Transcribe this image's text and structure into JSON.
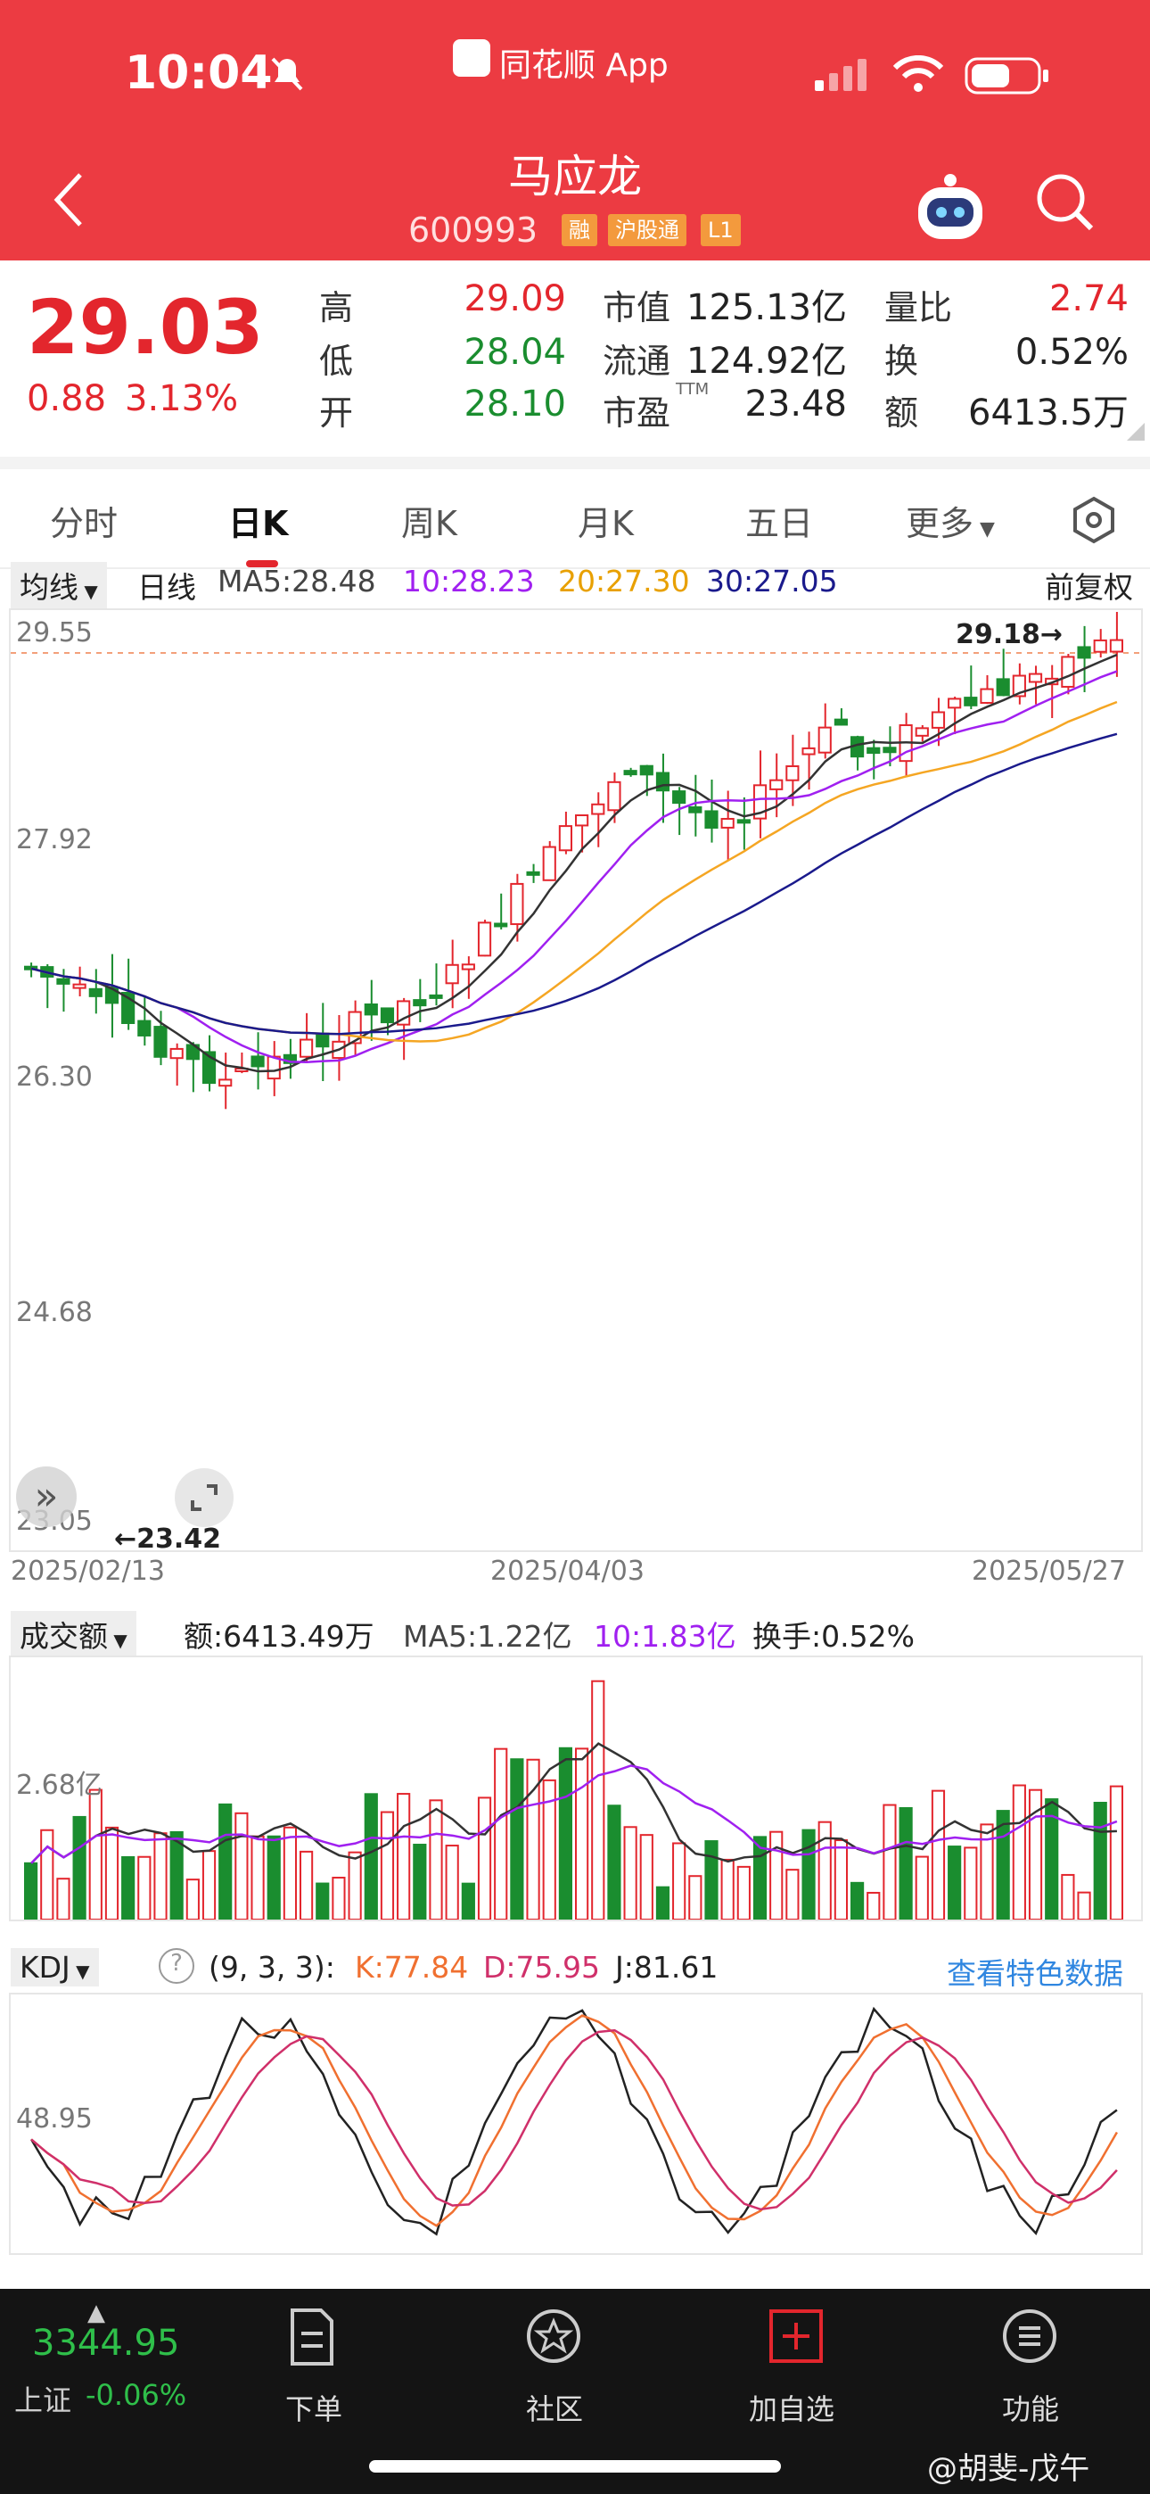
{
  "status": {
    "time": "10:04",
    "app_name": "同花顺 App"
  },
  "header": {
    "title": "马应龙",
    "code": "600993",
    "badges": [
      "融",
      "沪股通",
      "L1"
    ]
  },
  "quote": {
    "price": "29.03",
    "change": "0.88",
    "change_pct": "3.13%",
    "high_label": "高",
    "high": "29.09",
    "low_label": "低",
    "low": "28.04",
    "open_label": "开",
    "open": "28.10",
    "mcap_label": "市值",
    "mcap": "125.13亿",
    "float_label": "流通",
    "float": "124.92亿",
    "pe_label": "市盈",
    "pe_sup": "TTM",
    "pe": "23.48",
    "vr_label": "量比",
    "vr": "2.74",
    "turn_label": "换",
    "turn": "0.52%",
    "amt_label": "额",
    "amt": "6413.5万"
  },
  "tabs": [
    "分时",
    "日K",
    "周K",
    "月K",
    "五日",
    "更多"
  ],
  "kline": {
    "ma_selector": "均线",
    "period": "日线",
    "ma5": "MA5:28.48",
    "ma10": "10:28.23",
    "ma20": "20:27.30",
    "ma30": "30:27.05",
    "adjust": "前复权",
    "y_labels": [
      "29.55",
      "27.92",
      "26.30",
      "24.68",
      "23.05"
    ],
    "max_label": "29.18→",
    "min_label": "←23.42",
    "dates": [
      "2025/02/13",
      "2025/04/03",
      "2025/05/27"
    ]
  },
  "volume": {
    "selector": "成交额",
    "amount": "额:6413.49万",
    "ma5": "MA5:1.22亿",
    "ma10": "10:1.83亿",
    "turnover": "换手:0.52%",
    "y_label": "2.68亿"
  },
  "kdj": {
    "selector": "KDJ",
    "params": "(9, 3, 3):",
    "k": "K:77.84",
    "d": "D:75.95",
    "j": "J:81.61",
    "link": "查看特色数据",
    "y_label": "48.95"
  },
  "bottom": {
    "index_value": "3344.95",
    "index_name": "上证",
    "index_change": "-0.06%",
    "nav": [
      "下单",
      "社区",
      "加自选",
      "功能"
    ],
    "watermark": "@胡斐-戊午"
  },
  "colors": {
    "up": "#e3262d",
    "down": "#1a8d2f",
    "ma5": "#333333",
    "ma10": "#a020f0",
    "ma20": "#f5a623",
    "ma30": "#1a1a8c"
  }
}
